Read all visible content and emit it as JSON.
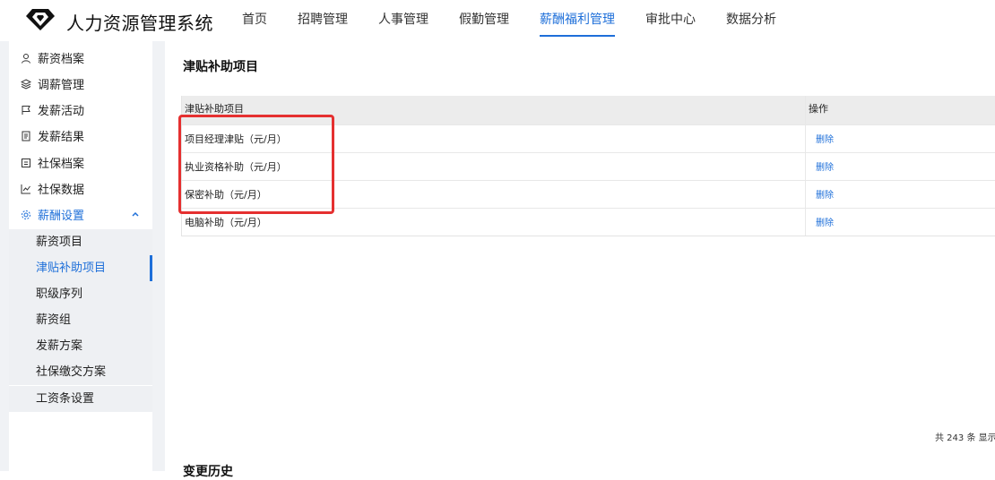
{
  "header": {
    "app_title": "人力资源管理系统",
    "nav": [
      "首页",
      "招聘管理",
      "人事管理",
      "假勤管理",
      "薪酬福利管理",
      "审批中心",
      "数据分析"
    ],
    "active_nav_index": 4,
    "accent": "#1e6fd9"
  },
  "sidebar": {
    "items": [
      {
        "label": "薪资档案",
        "icon": "user-icon"
      },
      {
        "label": "调薪管理",
        "icon": "layers-icon"
      },
      {
        "label": "发薪活动",
        "icon": "flag-icon"
      },
      {
        "label": "发薪结果",
        "icon": "document-icon"
      },
      {
        "label": "社保档案",
        "icon": "folder-icon"
      },
      {
        "label": "社保数据",
        "icon": "chart-line-icon"
      },
      {
        "label": "薪酬设置",
        "icon": "settings-icon"
      }
    ],
    "sub_items": [
      "薪资项目",
      "津贴补助项目",
      "职级序列",
      "薪资组",
      "发薪方案",
      "社保缴交方案",
      "工资条设置"
    ],
    "active_sub_index": 1
  },
  "main": {
    "section_title": "津贴补助项目",
    "table": {
      "headers": [
        "津贴补助项目",
        "操作"
      ],
      "rows": [
        {
          "name": "项目经理津贴（元/月）",
          "action": "删除"
        },
        {
          "name": "执业资格补助（元/月）",
          "action": "删除"
        },
        {
          "name": "保密补助（元/月）",
          "action": "删除"
        },
        {
          "name": "电脑补助（元/月）",
          "action": "删除"
        }
      ]
    },
    "pager_info": "共 243 条  显示",
    "history_title": "变更历史"
  }
}
